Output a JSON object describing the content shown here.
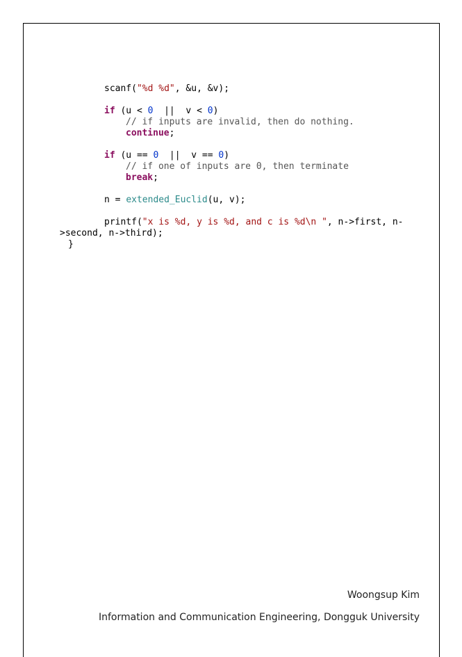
{
  "code": {
    "scanf": {
      "call": "scanf(",
      "fmt": "\"%d %d\"",
      "args": ", &u, &v);"
    },
    "if1": {
      "kw": "if",
      "a": " (u < ",
      "n1": "0",
      "b": "  ||  v < ",
      "n2": "0",
      "c": ")"
    },
    "cmt1": "// if inputs are invalid, then do nothing.",
    "continue_kw": "continue",
    "continue_semi": ";",
    "if2": {
      "kw": "if",
      "a": " (u == ",
      "n1": "0",
      "b": "  ||  v == ",
      "n2": "0",
      "c": ")"
    },
    "cmt2": "// if one of inputs are 0, then terminate",
    "break_kw": "break",
    "break_semi": ";",
    "assign": {
      "lhs": "n = ",
      "fn": "extended_Euclid",
      "args": "(u, v);"
    },
    "printf": {
      "call": "printf(",
      "fmt": "\"x is %d, y is %d, and c is %d\\n \"",
      "args": ", n->first, n-"
    },
    "printf_cont": ">second, n->third);",
    "close_brace": "}"
  },
  "footer": {
    "author": "Woongsup Kim",
    "affiliation": "Information and Communication Engineering, Dongguk University"
  }
}
